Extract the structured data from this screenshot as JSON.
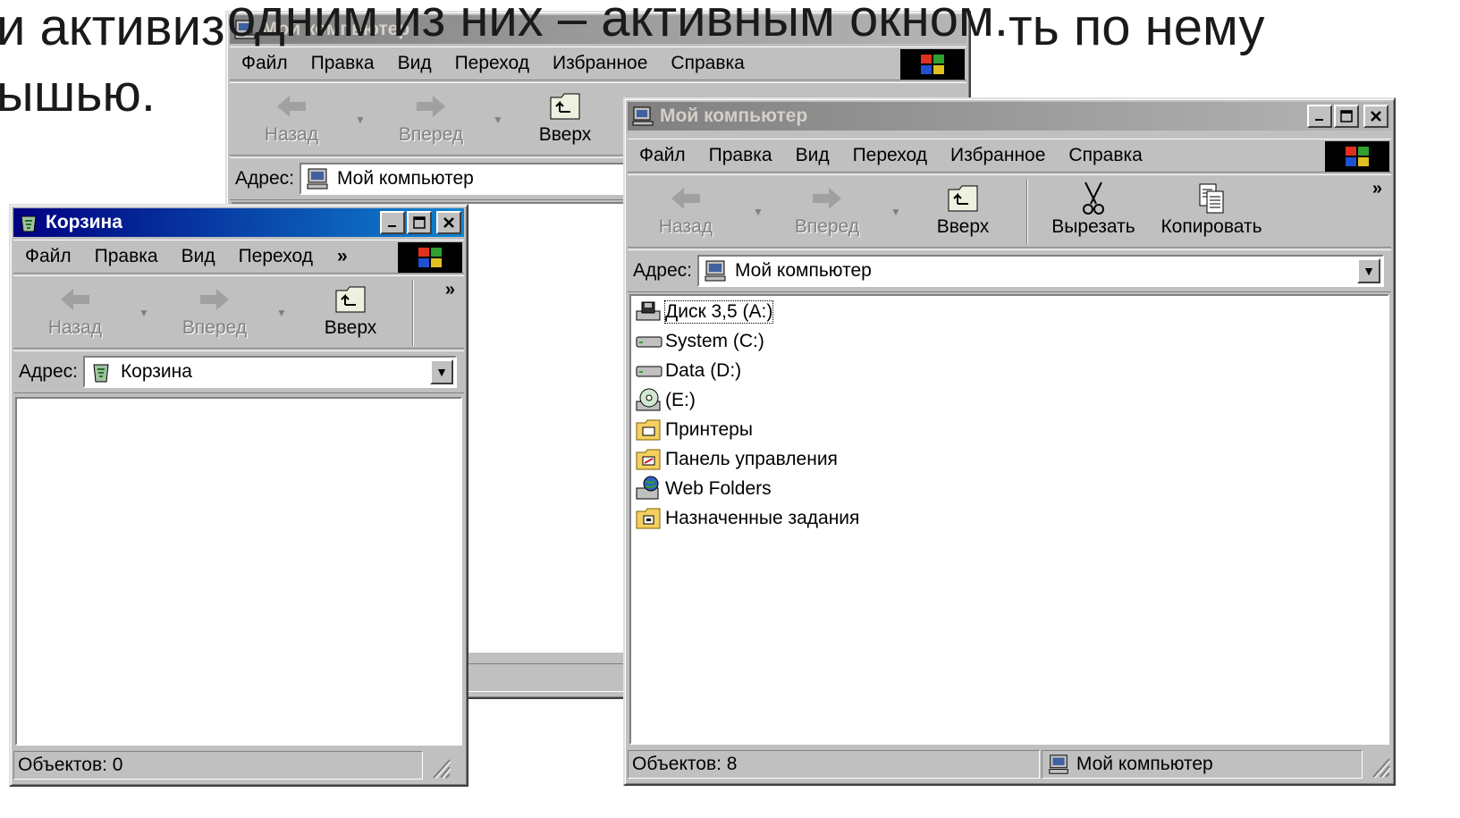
{
  "slide": {
    "line1_part1": "и активиз",
    "line1_overlay": "одним из них – активным окном.",
    "line1_part2": "ть по нему",
    "line2": "ышью."
  },
  "window_back": {
    "title": "Мой компьютер",
    "menu": [
      "Файл",
      "Правка",
      "Вид",
      "Переход",
      "Избранное",
      "Справка"
    ],
    "toolbar": {
      "back": "Назад",
      "forward": "Вперед",
      "up": "Вверх"
    },
    "address_label": "Адрес:",
    "address_value": "Мой компьютер"
  },
  "window_recycle": {
    "title": "Корзина",
    "menu": [
      "Файл",
      "Правка",
      "Вид",
      "Переход"
    ],
    "more_chevron": "»",
    "toolbar": {
      "back": "Назад",
      "forward": "Вперед",
      "up": "Вверх"
    },
    "address_label": "Адрес:",
    "address_value": "Корзина",
    "status": "Объектов: 0"
  },
  "window_main": {
    "title": "Мой компьютер",
    "menu": [
      "Файл",
      "Правка",
      "Вид",
      "Переход",
      "Избранное",
      "Справка"
    ],
    "more_chevron": "»",
    "toolbar": {
      "back": "Назад",
      "forward": "Вперед",
      "up": "Вверх",
      "cut": "Вырезать",
      "copy": "Копировать"
    },
    "address_label": "Адрес:",
    "address_value": "Мой компьютер",
    "items": [
      {
        "label": "Диск 3,5 (A:)",
        "icon": "floppy-drive-icon"
      },
      {
        "label": "System (C:)",
        "icon": "hard-drive-icon"
      },
      {
        "label": "Data (D:)",
        "icon": "hard-drive-icon"
      },
      {
        "label": "(E:)",
        "icon": "cd-drive-icon"
      },
      {
        "label": "Принтеры",
        "icon": "printers-folder-icon"
      },
      {
        "label": "Панель управления",
        "icon": "control-panel-folder-icon"
      },
      {
        "label": "Web Folders",
        "icon": "web-folders-icon"
      },
      {
        "label": "Назначенные задания",
        "icon": "scheduled-tasks-folder-icon"
      }
    ],
    "status_left": "Объектов: 8",
    "status_right": "Мой компьютер"
  },
  "colors": {
    "active_title_start": "#000080",
    "active_title_end": "#1084d0",
    "inactive_title_start": "#808080",
    "window_face": "#c0c0c0"
  }
}
